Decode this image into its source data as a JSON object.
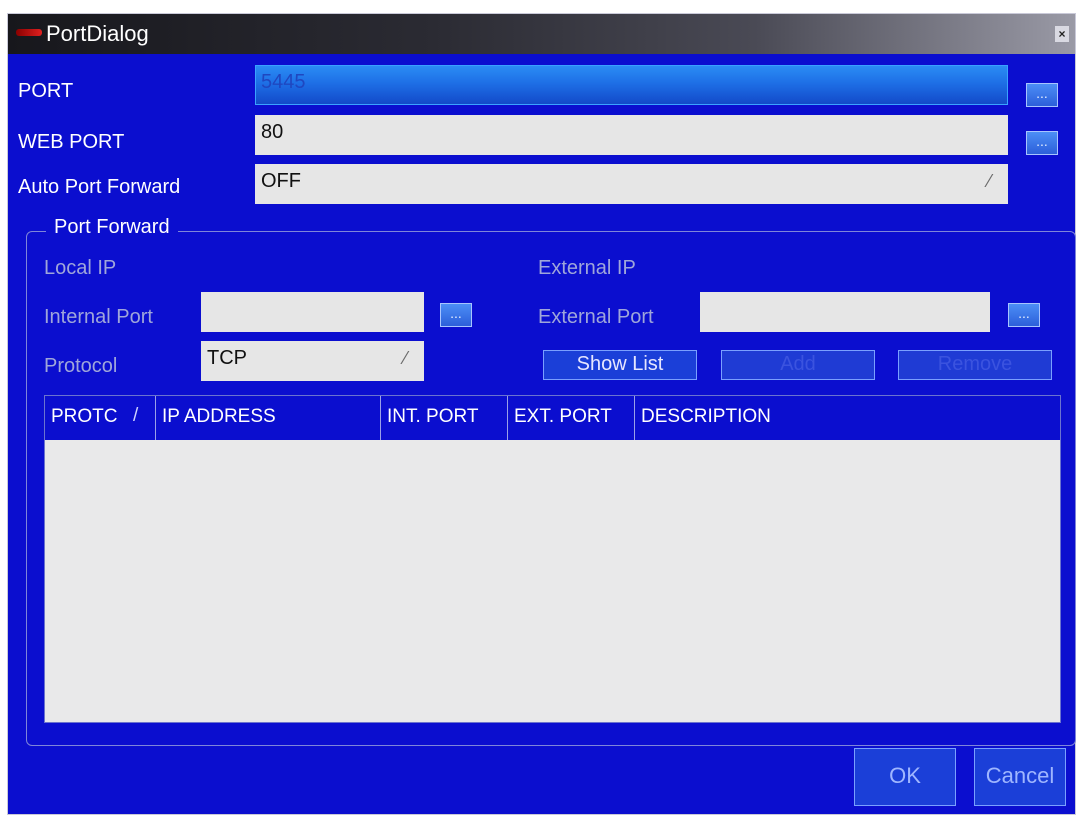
{
  "window": {
    "title": "PortDialog",
    "close_glyph": "×"
  },
  "fields": {
    "port": {
      "label": "PORT",
      "value": "5445",
      "button": "..."
    },
    "web_port": {
      "label": "WEB PORT",
      "value": "80",
      "button": "..."
    },
    "auto_port_forward": {
      "label": "Auto Port Forward",
      "value": "OFF"
    }
  },
  "port_forward": {
    "group_title": "Port Forward",
    "local_ip_label": "Local IP",
    "external_ip_label": "External IP",
    "internal_port_label": "Internal Port",
    "internal_port_value": "",
    "internal_port_button": "...",
    "external_port_label": "External Port",
    "external_port_value": "",
    "external_port_button": "...",
    "protocol_label": "Protocol",
    "protocol_value": "TCP",
    "show_list_button": "Show List",
    "add_button": "Add",
    "remove_button": "Remove"
  },
  "table": {
    "columns": [
      "PROTC",
      "IP ADDRESS",
      "INT. PORT",
      "EXT. PORT",
      "DESCRIPTION"
    ],
    "rows": []
  },
  "footer": {
    "ok": "OK",
    "cancel": "Cancel"
  },
  "colors": {
    "dialog_bg": "#0b0ecf",
    "field_bg": "#e6e6e6",
    "selected_field": "#1e6fe6",
    "title_bar": "#17171c"
  },
  "icons": {
    "app": "red-arrow-icon",
    "close": "close-icon",
    "combo": "dropdown-arrow-icon",
    "sort": "sort-indicator-icon"
  }
}
